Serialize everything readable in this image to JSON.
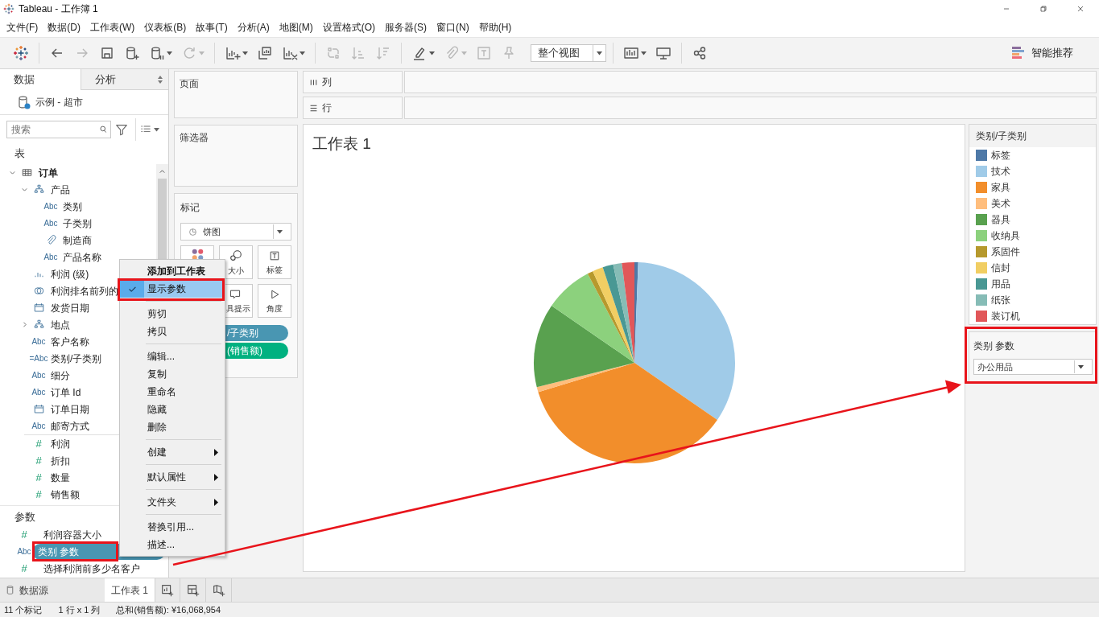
{
  "window": {
    "title": "Tableau - 工作簿 1"
  },
  "menu": [
    "文件(F)",
    "数据(D)",
    "工作表(W)",
    "仪表板(B)",
    "故事(T)",
    "分析(A)",
    "地图(M)",
    "设置格式(O)",
    "服务器(S)",
    "窗口(N)",
    "帮助(H)"
  ],
  "toolbar": {
    "groups": [
      [
        {
          "kind": "logo",
          "disabled": false,
          "dropdown": false
        }
      ],
      [
        {
          "kind": "back",
          "disabled": false,
          "dropdown": false
        },
        {
          "kind": "forward",
          "disabled": true,
          "dropdown": false
        },
        {
          "kind": "save",
          "disabled": false,
          "dropdown": false
        },
        {
          "kind": "new-data-source",
          "disabled": false,
          "dropdown": false
        },
        {
          "kind": "pause",
          "disabled": false,
          "dropdown": true
        },
        {
          "kind": "refresh",
          "disabled": true,
          "dropdown": true
        }
      ],
      [
        {
          "kind": "new-sheet",
          "disabled": false,
          "dropdown": true
        },
        {
          "kind": "duplicate",
          "disabled": false,
          "dropdown": false
        },
        {
          "kind": "clear",
          "disabled": false,
          "dropdown": true
        }
      ],
      [
        {
          "kind": "swap",
          "disabled": true,
          "dropdown": false
        },
        {
          "kind": "sort-asc",
          "disabled": true,
          "dropdown": false
        },
        {
          "kind": "sort-desc",
          "disabled": true,
          "dropdown": false
        }
      ],
      [
        {
          "kind": "highlight",
          "disabled": false,
          "dropdown": true
        },
        {
          "kind": "annotate",
          "disabled": true,
          "dropdown": true
        },
        {
          "kind": "text",
          "disabled": true,
          "dropdown": false
        },
        {
          "kind": "pin",
          "disabled": true,
          "dropdown": false
        },
        {
          "kind": "fit",
          "label": "整个视图",
          "disabled": false,
          "dropdown": true
        }
      ],
      [
        {
          "kind": "chart",
          "disabled": false,
          "dropdown": true
        },
        {
          "kind": "present",
          "disabled": false,
          "dropdown": false
        }
      ],
      [
        {
          "kind": "share",
          "disabled": false,
          "dropdown": false
        }
      ]
    ],
    "show_me": "智能推荐"
  },
  "data_pane": {
    "tabs": [
      {
        "label": "数据",
        "selected": true
      },
      {
        "label": "分析",
        "selected": false
      }
    ],
    "data_source": "示例 - 超市",
    "search": {
      "placeholder": "搜索"
    },
    "tables_heading": "表",
    "tables": [
      {
        "label": "订单",
        "kind": "table",
        "expanded": true,
        "children": [
          {
            "label": "产品",
            "kind": "hierarchy",
            "expanded": true,
            "children": [
              {
                "label": "类别",
                "kind": "abc",
                "badge": "Abc"
              },
              {
                "label": "子类别",
                "kind": "abc",
                "badge": "Abc"
              },
              {
                "label": "制造商",
                "kind": "attachment"
              },
              {
                "label": "产品名称",
                "kind": "abc",
                "badge": "Abc"
              }
            ]
          },
          {
            "label": "利润 (级)",
            "kind": "bins"
          },
          {
            "label": "利润排名前列的",
            "kind": "set"
          },
          {
            "label": "发货日期",
            "kind": "date"
          },
          {
            "label": "地点",
            "kind": "hierarchy",
            "expanded": false
          },
          {
            "label": "客户名称",
            "kind": "abc",
            "badge": "Abc"
          },
          {
            "label": "类别/子类别",
            "kind": "abc",
            "badge": "=Abc"
          },
          {
            "label": "细分",
            "kind": "abc",
            "badge": "Abc"
          },
          {
            "label": "订单 Id",
            "kind": "abc",
            "badge": "Abc"
          },
          {
            "label": "订单日期",
            "kind": "date"
          },
          {
            "label": "邮寄方式",
            "kind": "abc",
            "badge": "Abc"
          }
        ],
        "measures": [
          {
            "label": "利润",
            "kind": "measure",
            "badge": "#"
          },
          {
            "label": "折扣",
            "kind": "measure",
            "badge": "#"
          },
          {
            "label": "数量",
            "kind": "measure",
            "badge": "#"
          },
          {
            "label": "销售额",
            "kind": "measure",
            "badge": "#"
          }
        ]
      }
    ],
    "parameters_heading": "参数",
    "parameters": [
      {
        "label": "利润容器大小",
        "badge": "#",
        "selected": false
      },
      {
        "label": "类别 参数",
        "badge": "Abc",
        "selected": true
      },
      {
        "label": "选择利润前多少名客户",
        "badge": "#",
        "selected": false
      }
    ]
  },
  "shelves": {
    "pages": "页面",
    "filters": "筛选器",
    "columns": "列",
    "rows": "行"
  },
  "marks": {
    "title": "标记",
    "mark_type": "饼图",
    "buttons": [
      {
        "kind": "color"
      },
      {
        "kind": "size",
        "label": "大小"
      },
      {
        "kind": "label",
        "label": "标签"
      },
      {
        "kind": "tooltip",
        "label": "具提示"
      },
      {
        "kind": "angle",
        "label": "角度"
      }
    ],
    "pills": [
      {
        "label": "/子类别",
        "kind": "dimension"
      },
      {
        "label": "(销售额)",
        "kind": "measure"
      }
    ]
  },
  "context_menu": {
    "groups": [
      [
        {
          "label": "添加到工作表",
          "default": true,
          "checked": false,
          "selected": false,
          "submenu": false
        },
        {
          "label": "显示参数",
          "default": false,
          "checked": true,
          "selected": true,
          "submenu": false
        }
      ],
      [
        {
          "label": "剪切",
          "default": false,
          "checked": false,
          "selected": false,
          "submenu": false
        },
        {
          "label": "拷贝",
          "default": false,
          "checked": false,
          "selected": false,
          "submenu": false
        }
      ],
      [
        {
          "label": "编辑...",
          "default": false,
          "checked": false,
          "selected": false,
          "submenu": false
        },
        {
          "label": "复制",
          "default": false,
          "checked": false,
          "selected": false,
          "submenu": false
        },
        {
          "label": "重命名",
          "default": false,
          "checked": false,
          "selected": false,
          "submenu": false
        },
        {
          "label": "隐藏",
          "default": false,
          "checked": false,
          "selected": false,
          "submenu": false
        },
        {
          "label": "删除",
          "default": false,
          "checked": false,
          "selected": false,
          "submenu": false
        }
      ],
      [
        {
          "label": "创建",
          "default": false,
          "checked": false,
          "selected": false,
          "submenu": true
        }
      ],
      [
        {
          "label": "默认属性",
          "default": false,
          "checked": false,
          "selected": false,
          "submenu": true
        }
      ],
      [
        {
          "label": "文件夹",
          "default": false,
          "checked": false,
          "selected": false,
          "submenu": true
        }
      ],
      [
        {
          "label": "替换引用...",
          "default": false,
          "checked": false,
          "selected": false,
          "submenu": false
        },
        {
          "label": "描述...",
          "default": false,
          "checked": false,
          "selected": false,
          "submenu": false
        }
      ]
    ]
  },
  "worksheet": {
    "title": "工作表 1"
  },
  "legend": {
    "title": "类别/子类别",
    "items": [
      {
        "label": "标签",
        "color": "#4e79a7"
      },
      {
        "label": "技术",
        "color": "#a0cbe8"
      },
      {
        "label": "家具",
        "color": "#f28e2b"
      },
      {
        "label": "美术",
        "color": "#ffbe7d"
      },
      {
        "label": "器具",
        "color": "#59a14f"
      },
      {
        "label": "收纳具",
        "color": "#8cd17d"
      },
      {
        "label": "系固件",
        "color": "#b6992d"
      },
      {
        "label": "信封",
        "color": "#f1ce63"
      },
      {
        "label": "用品",
        "color": "#499894"
      },
      {
        "label": "纸张",
        "color": "#86bcb6"
      },
      {
        "label": "装订机",
        "color": "#e15759"
      }
    ]
  },
  "parameter_control": {
    "title": "类别 参数",
    "value": "办公用品"
  },
  "sheet_tabs": {
    "data_source": "数据源",
    "sheets": [
      {
        "label": "工作表 1",
        "selected": true
      }
    ]
  },
  "status_bar": [
    "11 个标记",
    "1 行 x 1 列",
    "总和(销售额): ¥16,068,954"
  ]
}
